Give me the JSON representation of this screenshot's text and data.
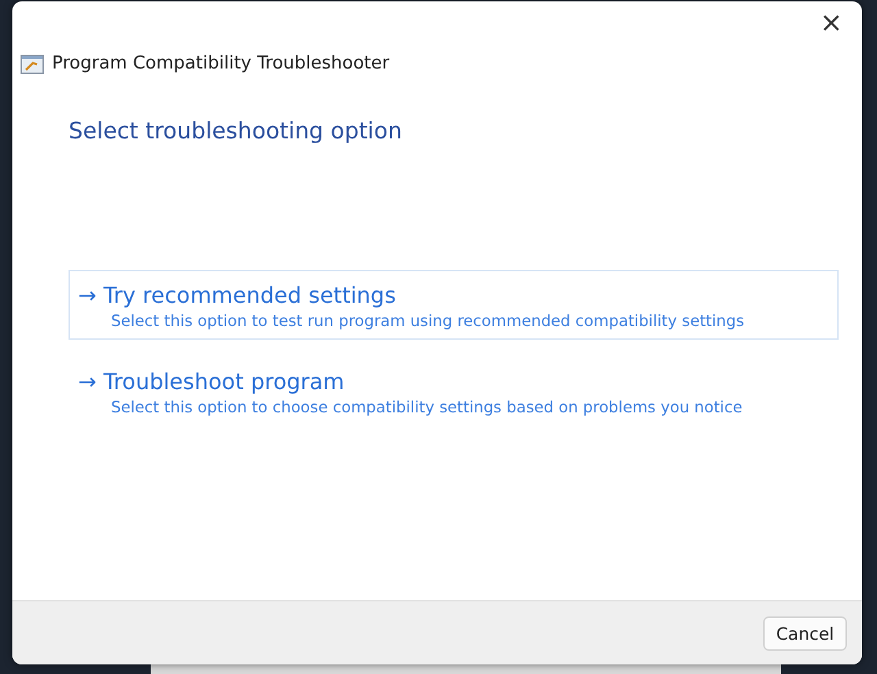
{
  "window": {
    "title": "Program Compatibility Troubleshooter",
    "close": "×"
  },
  "heading": "Select troubleshooting option",
  "options": [
    {
      "arrow": "→",
      "title": "Try recommended settings",
      "description": "Select this option to test run program using recommended compatibility settings",
      "selected": true
    },
    {
      "arrow": "→",
      "title": "Troubleshoot program",
      "description": "Select this option to choose compatibility settings based on problems you notice",
      "selected": false
    }
  ],
  "buttons": [
    "Cancel"
  ]
}
